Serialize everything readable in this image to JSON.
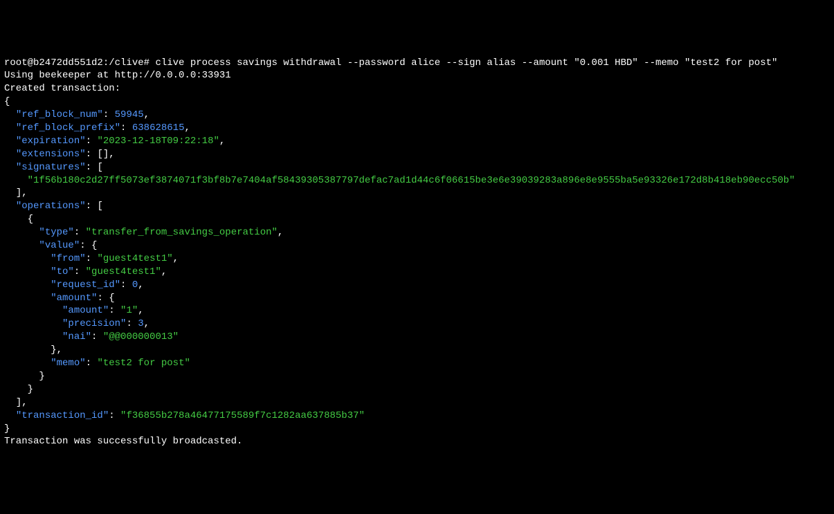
{
  "prompt": "root@b2472dd551d2:/clive#",
  "command": "clive process savings withdrawal --password alice --sign alias --amount \"0.001 HBD\" --memo \"test2 for post\"",
  "beekeeper_line": "Using beekeeper at http://0.0.0.0:33931",
  "created_line": "Created transaction:",
  "json": {
    "ref_block_num_key": "\"ref_block_num\"",
    "ref_block_num_val": "59945",
    "ref_block_prefix_key": "\"ref_block_prefix\"",
    "ref_block_prefix_val": "638628615",
    "expiration_key": "\"expiration\"",
    "expiration_val": "\"2023-12-18T09:22:18\"",
    "extensions_key": "\"extensions\"",
    "extensions_val": "[]",
    "signatures_key": "\"signatures\"",
    "signature_val": "\"1f56b180c2d27ff5073ef3874071f3bf8b7e7404af58439305387797defac7ad1d44c6f06615be3e6e39039283a896e8e9555ba5e93326e172d8b418eb90ecc50b\"",
    "operations_key": "\"operations\"",
    "type_key": "\"type\"",
    "type_val": "\"transfer_from_savings_operation\"",
    "value_key": "\"value\"",
    "from_key": "\"from\"",
    "from_val": "\"guest4test1\"",
    "to_key": "\"to\"",
    "to_val": "\"guest4test1\"",
    "request_id_key": "\"request_id\"",
    "request_id_val": "0",
    "amount_key": "\"amount\"",
    "amount_inner_key": "\"amount\"",
    "amount_inner_val": "\"1\"",
    "precision_key": "\"precision\"",
    "precision_val": "3",
    "nai_key": "\"nai\"",
    "nai_val": "\"@@000000013\"",
    "memo_key": "\"memo\"",
    "memo_val": "\"test2 for post\"",
    "transaction_id_key": "\"transaction_id\"",
    "transaction_id_val": "\"f36855b278a46477175589f7c1282aa637885b37\""
  },
  "broadcast_line": "Transaction was successfully broadcasted."
}
